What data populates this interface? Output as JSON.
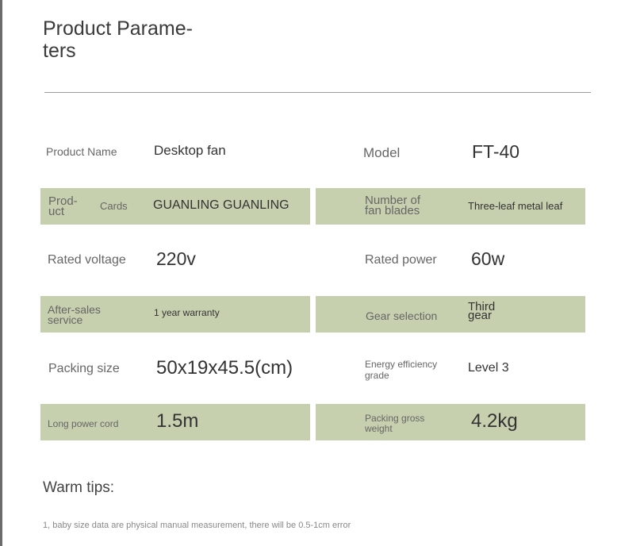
{
  "title": "Product Parame-\nters",
  "rows": [
    {
      "left_label": "Product Name",
      "left_value": "Desktop fan",
      "right_label": "Model",
      "right_value": "FT-40"
    },
    {
      "left_label": "Prod-\nuct",
      "left_sublabel": "Cards",
      "left_value": "GUANLING GUANLING",
      "right_label": "Number of\nfan blades",
      "right_value": "Three-leaf metal leaf"
    },
    {
      "left_label": "Rated voltage",
      "left_value": "220v",
      "right_label": "Rated power",
      "right_value": "60w"
    },
    {
      "left_label": "After-sales\nservice",
      "left_value": "1 year warranty",
      "right_label": "Gear selection",
      "right_value": "Third\ngear"
    },
    {
      "left_label": "Packing size",
      "left_value": "50x19x45.5(cm)",
      "right_label": "Energy efficiency\ngrade",
      "right_value": "Level 3"
    },
    {
      "left_label": "Long power cord",
      "left_value": "1.5m",
      "right_label": "Packing gross\nweight",
      "right_value": "4.2kg"
    }
  ],
  "tips": {
    "title": "Warm tips:",
    "items": [
      "1, baby size data are physical manual measurement, there will be 0.5-1cm error"
    ]
  },
  "colors": {
    "band": "#c6d0ae",
    "divider": "#9a9a9a"
  }
}
